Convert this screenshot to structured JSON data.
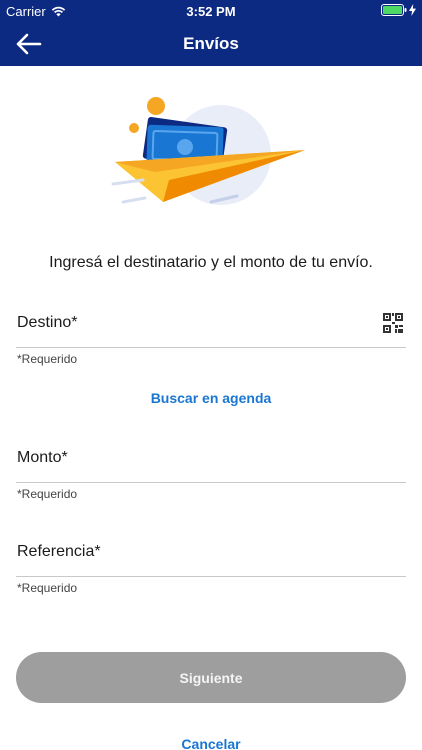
{
  "status_bar": {
    "carrier": "Carrier",
    "time": "3:52 PM"
  },
  "header": {
    "title": "Envíos",
    "back_icon": "arrow-left-icon"
  },
  "intro_text": "Ingresá el destinatario y el monto de tu envío.",
  "form": {
    "destino": {
      "label": "Destino*",
      "helper": "*Requerido",
      "icon": "qr-code-icon"
    },
    "agenda_link": "Buscar en agenda",
    "monto": {
      "label": "Monto*",
      "helper": "*Requerido"
    },
    "referencia": {
      "label": "Referencia*",
      "helper": "*Requerido"
    }
  },
  "actions": {
    "next_label": "Siguiente",
    "cancel_label": "Cancelar"
  },
  "colors": {
    "header_bg": "#0d2a82",
    "link": "#1976d2",
    "button_disabled": "#9e9e9e",
    "battery": "#4cd964"
  }
}
